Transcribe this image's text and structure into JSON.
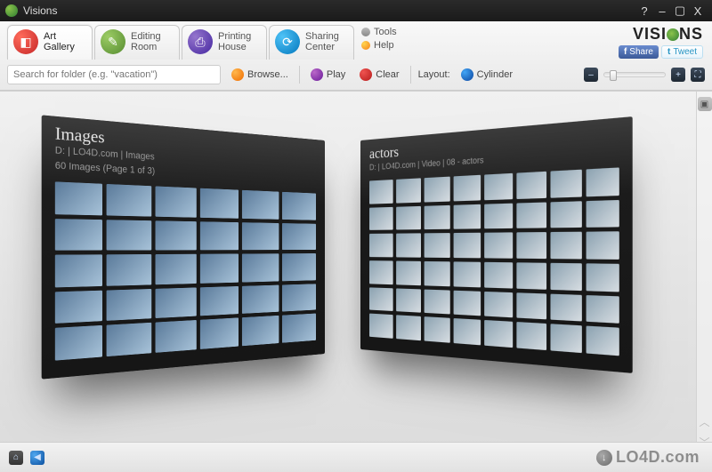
{
  "titlebar": {
    "title": "Visions"
  },
  "tabs": [
    {
      "line1": "Art",
      "line2": "Gallery",
      "icon": "red",
      "active": true
    },
    {
      "line1": "Editing",
      "line2": "Room",
      "icon": "green",
      "active": false
    },
    {
      "line1": "Printing",
      "line2": "House",
      "icon": "purple",
      "active": false
    },
    {
      "line1": "Sharing",
      "line2": "Center",
      "icon": "blue",
      "active": false
    }
  ],
  "sideMenu": {
    "tools": "Tools",
    "help": "Help"
  },
  "logo": {
    "text_left": "VISI",
    "text_right": "NS"
  },
  "social": {
    "share": "Share",
    "tweet": "Tweet"
  },
  "toolbar": {
    "search_placeholder": "Search for folder (e.g. \"vacation\")",
    "browse": "Browse...",
    "play": "Play",
    "clear": "Clear",
    "layout_label": "Layout:",
    "layout_value": "Cylinder"
  },
  "panels": {
    "left": {
      "title": "Images",
      "path": "D: | LO4D.com | Images",
      "meta": "60 Images (Page 1 of 3)"
    },
    "right": {
      "title": "actors",
      "path": "D: | LO4D.com | Video | 08 - actors",
      "meta": ""
    }
  },
  "watermark": "LO4D.com"
}
